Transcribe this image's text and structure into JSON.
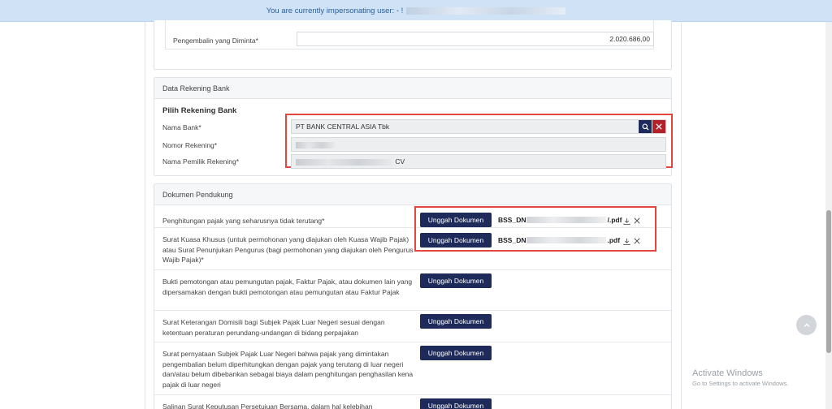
{
  "banner": {
    "text": "You are currently impersonating user: - !"
  },
  "refund": {
    "label": "Pengembalin yang Diminta*",
    "value": "2.020.686,00"
  },
  "bank": {
    "header": "Data Rekening Bank",
    "title": "Pilih Rekening Bank",
    "name_label": "Nama Bank*",
    "name_value": "PT BANK CENTRAL ASIA Tbk",
    "number_label": "Nomor Rekening*",
    "number_value": "",
    "owner_label": "Nama Pemilik Rekening*",
    "owner_value": "CV",
    "search_icon": "search-icon",
    "clear_icon": "close-icon"
  },
  "docs": {
    "header": "Dokumen Pendukung",
    "upload_label": "Unggah Dokumen",
    "rows": [
      {
        "label": "Penghitungan pajak yang seharusnya tidak terutang*",
        "file_prefix": "BSS_DN",
        "file_suffix": "/.pdf"
      },
      {
        "label": "Surat Kuasa Khusus (untuk permohonan yang diajukan oleh Kuasa Wajib Pajak) atau Surat Penunjukan Pengurus (bagi permohonan yang diajukan oleh Pengurus Wajib Pajak)*",
        "file_prefix": "BSS_DN",
        "file_suffix": ".pdf"
      },
      {
        "label": "Bukti pemotongan atau pemungutan pajak, Faktur Pajak, atau dokumen lain yang dipersamakan dengan bukti pemotongan atau pemungutan atau Faktur Pajak"
      },
      {
        "label": "Surat Keterangan Domisili bagi Subjek Pajak Luar Negeri sesuai dengan ketentuan peraturan perundang-undangan di bidang perpajakan"
      },
      {
        "label": "Surat pernyataan Subjek Pajak Luar Negeri bahwa pajak yang dimintakan pengembalian belum diperhitungkan dengan pajak yang terutang di luar negeri dan/atau belum dibebankan sebagai biaya dalam penghitungan penghasilan kena pajak di luar negeri"
      },
      {
        "label": "Salinan Surat Keputusan Persetujuan Bersama, dalam hal kelebihan"
      }
    ]
  },
  "watermark": {
    "title": "Activate Windows",
    "subtitle": "Go to Settings to activate Windows."
  }
}
